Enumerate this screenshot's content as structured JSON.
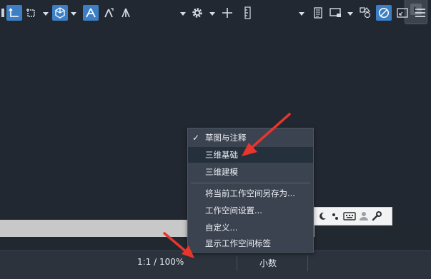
{
  "workspace_menu": {
    "items": [
      {
        "label": "草图与注释",
        "checked": true
      },
      {
        "label": "三维基础",
        "hovered": true
      },
      {
        "label": "三维建模"
      },
      {
        "label": "将当前工作空间另存为..."
      },
      {
        "label": "工作空间设置..."
      },
      {
        "label": "自定义..."
      },
      {
        "label": "显示工作空间标签"
      }
    ],
    "check_glyph": "✓"
  },
  "status_bar": {
    "annotation_scale": "1:1 / 100%",
    "units": "小数"
  },
  "colors": {
    "accent": "#3d7fc4",
    "menu_bg": "#3b4350",
    "menu_hover": "#25303d",
    "annotation_arrow": "#e8352d"
  },
  "icons": [
    "view-cube-icon",
    "moon-icon",
    "keyboard-icon",
    "user-icon",
    "wrench-icon",
    "workspace-gear-icon",
    "plus-icon",
    "ruler-icon",
    "properties-icon",
    "viewport-icon",
    "isolate-icon",
    "clean-screen-icon",
    "fullscreen-icon",
    "customize-menu-icon"
  ]
}
